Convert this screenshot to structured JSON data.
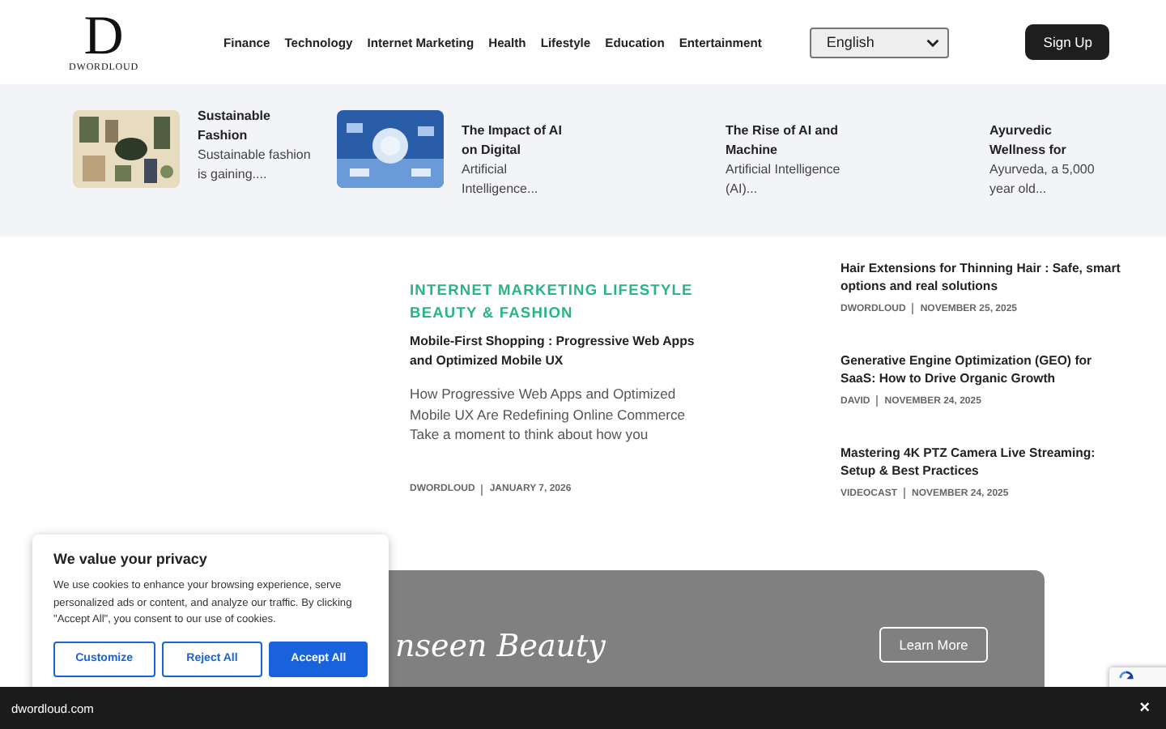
{
  "header": {
    "logo": {
      "letter": "D",
      "wordmark": "DWORDLOUD"
    },
    "nav": [
      "Finance",
      "Technology",
      "Internet Marketing",
      "Health",
      "Lifestyle",
      "Education",
      "Entertainment"
    ],
    "language": {
      "value": "English"
    },
    "sign_up": "Sign Up"
  },
  "featured_strip": [
    {
      "kind": "picture",
      "title": "Sustainable Fashion",
      "excerpt": "Sustainable fashion is gaining...."
    },
    {
      "kind": "picture",
      "title": "The Impact of AI on Digital",
      "excerpt": "Artificial Intelligence..."
    },
    {
      "kind": "text",
      "title": "The Rise of AI and Machine",
      "excerpt": "Artificial Intelligence (AI)..."
    },
    {
      "kind": "text",
      "title": "Ayurvedic Wellness for",
      "excerpt": "Ayurveda, a 5,000 year old..."
    }
  ],
  "main_post": {
    "categories": "INTERNET MARKETING LIFESTYLE BEAUTY & FASHION",
    "title": "Mobile-First Shopping : Progressive Web Apps and Optimized Mobile UX",
    "excerpt": "How Progressive Web Apps and Optimized Mobile UX Are Redefining Online Commerce Take a moment to think about how you",
    "author": "DWORDLOUD",
    "date": "JANUARY 7, 2026"
  },
  "side_posts": [
    {
      "title": "Hair Extensions for Thinning Hair : Safe, smart options and real solutions",
      "author": "DWORDLOUD",
      "date": "NOVEMBER 25, 2025"
    },
    {
      "title": "Generative Engine Optimization (GEO) for SaaS: How to Drive Organic Growth",
      "author": "DAVID",
      "date": "NOVEMBER 24, 2025"
    },
    {
      "title": "Mastering 4K PTZ Camera Live Streaming: Setup & Best Practices",
      "author": "VIDEOCAST",
      "date": "NOVEMBER 24, 2025"
    }
  ],
  "banner": {
    "heading": "nseen Beauty",
    "button": "Learn More"
  },
  "cookie_dialog": {
    "title": "We value your privacy",
    "text": "We use cookies to enhance your browsing experience, serve personalized ads or content, and analyze our traffic. By clicking \"Accept All\", you consent to our use of cookies.",
    "buttons": [
      {
        "label": "Customize",
        "kind": "outline"
      },
      {
        "label": "Reject All",
        "kind": "outline"
      },
      {
        "label": "Accept All",
        "kind": "primary"
      }
    ]
  },
  "footer_bar": {
    "site": "dwordloud.com",
    "close": "×"
  }
}
